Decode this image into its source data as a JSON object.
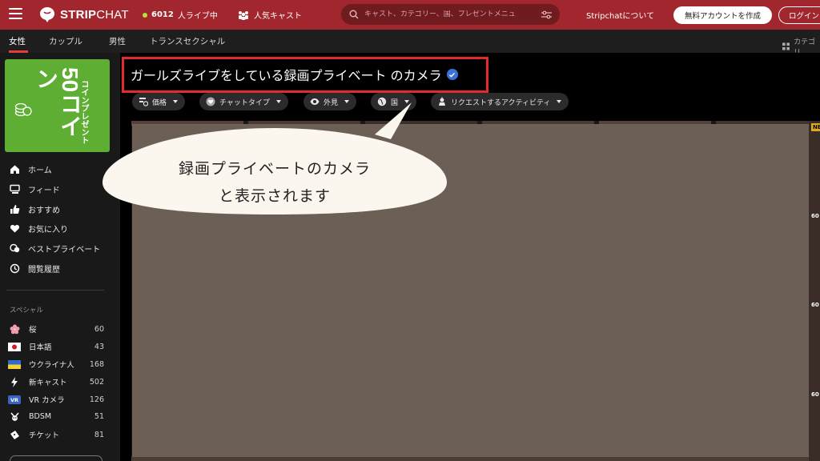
{
  "header": {
    "logo_bold": "STRIP",
    "logo_light": "CHAT",
    "live_count": "6012",
    "live_label": "人ライブ中",
    "popular_label": "人気キャスト",
    "search_placeholder": "キャスト、カテゴリー、国、プレゼントメニュ",
    "about_label": "Stripchatについて",
    "create_account_label": "無料アカウントを作成",
    "login_label": "ログイン"
  },
  "category_tabs": [
    {
      "label": "女性",
      "active": true
    },
    {
      "label": "カップル",
      "active": false
    },
    {
      "label": "男性",
      "active": false
    },
    {
      "label": "トランスセクシャル",
      "active": false
    }
  ],
  "category_right_label": "カテゴリ",
  "sidebar": {
    "promo": {
      "big": "50コイン",
      "small": "コインプレゼント"
    },
    "nav": [
      {
        "label": "ホーム",
        "icon": "home-icon"
      },
      {
        "label": "フィード",
        "icon": "feed-icon"
      },
      {
        "label": "おすすめ",
        "icon": "thumbs-up-icon"
      },
      {
        "label": "お気に入り",
        "icon": "heart-icon"
      },
      {
        "label": "ベストプライベート",
        "icon": "chat-bubbles-icon"
      },
      {
        "label": "閲覧履歴",
        "icon": "history-icon"
      }
    ],
    "special_title": "スペシャル",
    "special": [
      {
        "label": "桜",
        "count": "60",
        "icon": "sakura-icon"
      },
      {
        "label": "日本語",
        "count": "43",
        "icon": "japan-flag-icon"
      },
      {
        "label": "ウクライナ人",
        "count": "168",
        "icon": "ukraine-flag-icon"
      },
      {
        "label": "新キャスト",
        "count": "502",
        "icon": "lightning-icon"
      },
      {
        "label": "VR カメラ",
        "count": "126",
        "icon": "vr-icon"
      },
      {
        "label": "BDSM",
        "count": "51",
        "icon": "bdsm-icon"
      },
      {
        "label": "チケット",
        "count": "81",
        "icon": "ticket-icon"
      }
    ]
  },
  "main": {
    "title": "ガールズライブをしている録画プライベート のカメラ",
    "filters": [
      {
        "label": "価格",
        "icon": "price-icon"
      },
      {
        "label": "チャットタイプ",
        "icon": "chat-type-icon"
      },
      {
        "label": "外見",
        "icon": "eye-icon"
      },
      {
        "label": "国",
        "icon": "globe-icon"
      },
      {
        "label": "リクエストするアクティビティ",
        "icon": "activity-icon"
      }
    ],
    "badges": [
      "NEW",
      "60",
      "60",
      "60"
    ]
  },
  "annotation": {
    "text": "録画プライベートのカメラ\nと表示されます"
  },
  "colors": {
    "header_bg": "#a2262e",
    "promo_green": "#5fae34",
    "highlight_red": "#e42a2a",
    "bubble_bg": "#fbf6ee"
  }
}
